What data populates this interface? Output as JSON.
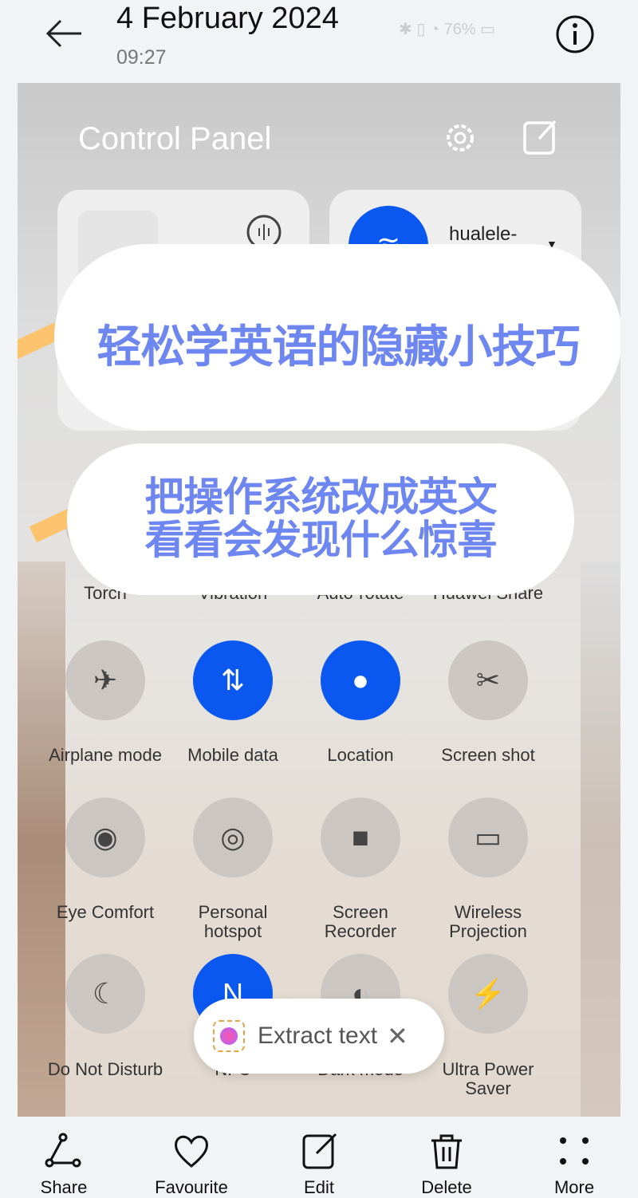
{
  "header": {
    "date": "4 February 2024",
    "time": "09:27",
    "status": "✱ ▯ ◔ 76% ▭"
  },
  "panel": {
    "title": "Control Panel",
    "wifi_name": "hualele-"
  },
  "overlay": {
    "headline": "轻松学英语的隐藏小技巧",
    "line1": "把操作系统改成英文",
    "line2": "看看会发现什么惊喜"
  },
  "tiles": [
    {
      "label": "Torch",
      "icon": "torch-icon",
      "on": false
    },
    {
      "label": "Vibration",
      "icon": "vibration-icon",
      "on": false
    },
    {
      "label": "Auto-rotate",
      "icon": "rotate-icon",
      "on": false
    },
    {
      "label": "Huawei Share",
      "icon": "share-icon",
      "on": false
    },
    {
      "label": "Airplane mode",
      "icon": "airplane-icon",
      "glyph": "✈",
      "on": false
    },
    {
      "label": "Mobile data",
      "icon": "mobile-data-icon",
      "glyph": "⇅",
      "on": true
    },
    {
      "label": "Location",
      "icon": "location-icon",
      "glyph": "●",
      "on": true
    },
    {
      "label": "Screen shot",
      "icon": "screenshot-icon",
      "glyph": "✂",
      "on": false
    },
    {
      "label": "Eye Comfort",
      "icon": "eye-icon",
      "glyph": "◉",
      "on": false
    },
    {
      "label": "Personal hotspot",
      "icon": "hotspot-icon",
      "glyph": "◎",
      "on": false
    },
    {
      "label": "Screen Recorder",
      "icon": "video-icon",
      "glyph": "■",
      "on": false
    },
    {
      "label": "Wireless Projection",
      "icon": "projection-icon",
      "glyph": "▭",
      "on": false
    },
    {
      "label": "Do Not Disturb",
      "icon": "moon-icon",
      "glyph": "☾",
      "on": false
    },
    {
      "label": "NFC",
      "icon": "nfc-icon",
      "glyph": "N",
      "on": true
    },
    {
      "label": "Dark mode",
      "icon": "dark-mode-icon",
      "glyph": "◐",
      "on": false
    },
    {
      "label": "Ultra Power Saver",
      "icon": "battery-icon",
      "glyph": "⚡",
      "on": false
    }
  ],
  "extract": {
    "label": "Extract text"
  },
  "toolbar": {
    "share": "Share",
    "favourite": "Favourite",
    "edit": "Edit",
    "delete": "Delete",
    "more": "More"
  },
  "colors": {
    "accent": "#0a58f0",
    "overlay_text": "#6e86ef",
    "stripe": "#fbc36e"
  }
}
